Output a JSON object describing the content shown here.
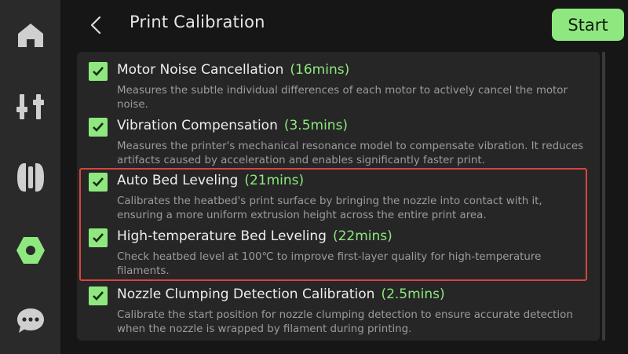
{
  "header": {
    "title": "Print Calibration",
    "start_label": "Start"
  },
  "sidebar": {
    "items": [
      {
        "icon": "home-icon"
      },
      {
        "icon": "controls-icon"
      },
      {
        "icon": "filament-icon"
      },
      {
        "icon": "calibration-nut-icon",
        "active": true
      },
      {
        "icon": "chat-icon"
      }
    ]
  },
  "calibration": {
    "items": [
      {
        "title": "Motor Noise Cancellation",
        "time": "(16mins)",
        "checked": true,
        "desc": "Measures the subtle individual differences of each motor to actively cancel the motor noise."
      },
      {
        "title": "Vibration Compensation",
        "time": "(3.5mins)",
        "checked": true,
        "desc": "Measures the printer's mechanical resonance model to compensate vibration. It reduces artifacts caused by acceleration and enables significantly faster print."
      },
      {
        "title": "Auto Bed Leveling",
        "time": "(21mins)",
        "checked": true,
        "desc": "Calibrates the heatbed's print surface by bringing the nozzle into contact with it, ensuring a more uniform extrusion height across the entire print area."
      },
      {
        "title": "High-temperature Bed Leveling",
        "time": "(22mins)",
        "checked": true,
        "desc": "Check heatbed level at 100℃ to improve first-layer quality for high-temperature filaments."
      },
      {
        "title": "Nozzle Clumping Detection Calibration",
        "time": "(2.5mins)",
        "checked": true,
        "desc": "Calibrate the start position for nozzle clumping detection to ensure accurate detection when the nozzle is wrapped by filament during printing."
      }
    ]
  },
  "colors": {
    "accent": "#8ee87f",
    "highlight": "#d9443f",
    "background": "#161616",
    "panel": "#262626",
    "sidebar": "#2a2a2a"
  }
}
